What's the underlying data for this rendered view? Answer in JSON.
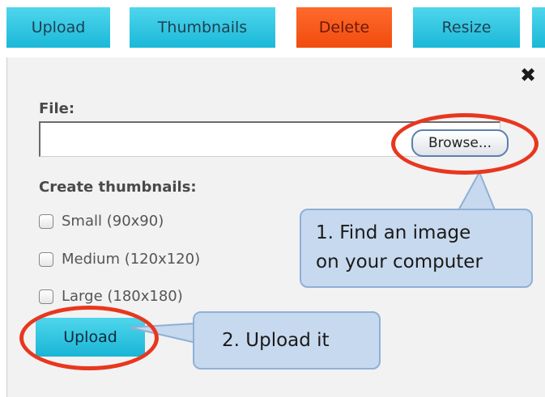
{
  "tabs": [
    {
      "label": "Upload"
    },
    {
      "label": "Thumbnails"
    },
    {
      "label": "Delete"
    },
    {
      "label": "Resize"
    }
  ],
  "form": {
    "file_label": "File:",
    "file_value": "",
    "browse_label": "Browse...",
    "thumbnails_label": "Create thumbnails:",
    "options": [
      {
        "label": "Small (90x90)",
        "checked": false
      },
      {
        "label": "Medium (120x120)",
        "checked": false
      },
      {
        "label": "Large (180x180)",
        "checked": false
      }
    ],
    "upload_label": "Upload"
  },
  "annotations": {
    "callout1_line1": "1. Find an image",
    "callout1_line2": "on your computer",
    "callout2": "2. Upload it",
    "highlight_color": "#e8371f",
    "callout_fill": "#c7d9ee"
  },
  "colors": {
    "tab_cyan": "#1ab8d8",
    "tab_delete": "#f04c0e",
    "panel_bg": "#f2f2f2"
  }
}
